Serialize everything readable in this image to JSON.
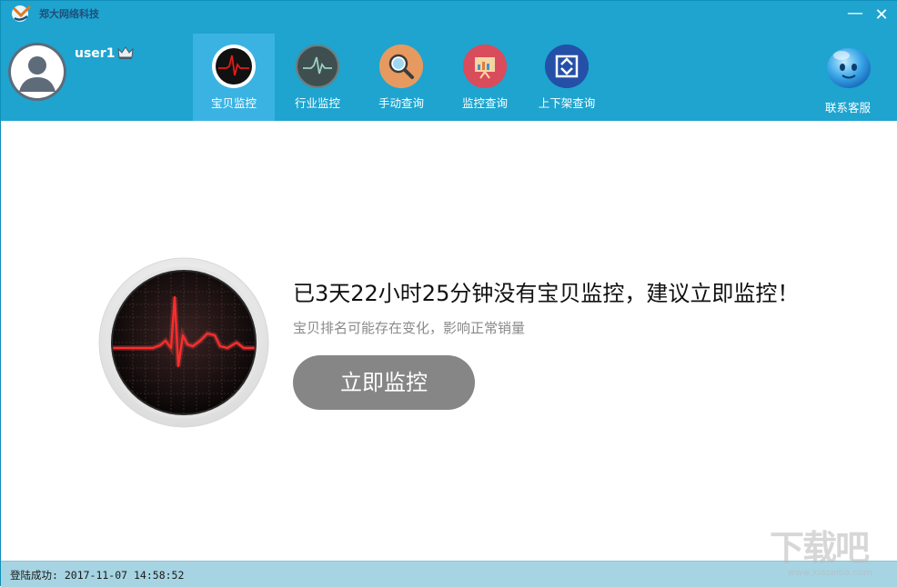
{
  "app": {
    "brand": "郑大网络科技",
    "minimize_symbol": "—",
    "close_symbol": "✕"
  },
  "user": {
    "name": "user1"
  },
  "nav": {
    "items": [
      {
        "label": "宝贝监控",
        "icon": "heartbeat-icon",
        "active": true
      },
      {
        "label": "行业监控",
        "icon": "pulse-monitor-icon",
        "active": false
      },
      {
        "label": "手动查询",
        "icon": "magnifier-icon",
        "active": false
      },
      {
        "label": "监控查询",
        "icon": "report-chart-icon",
        "active": false
      },
      {
        "label": "上下架查询",
        "icon": "shelf-icon",
        "active": false
      }
    ]
  },
  "service": {
    "label": "联系客服",
    "icon": "smiley-bubble-icon"
  },
  "main": {
    "headline": "已3天22小时25分钟没有宝贝监控，建议立即监控！",
    "subline": "宝贝排名可能存在变化，影响正常销量",
    "cta_label": "立即监控"
  },
  "status": {
    "text": "登陆成功: 2017-11-07 14:58:52"
  },
  "watermark": {
    "big": "下载吧",
    "small": "www.xiazaiba.com"
  },
  "colors": {
    "header": "#1ea4cf",
    "nav_active": "#3bb3e2",
    "cta": "#868686",
    "statusbar": "#a6d4e3"
  }
}
